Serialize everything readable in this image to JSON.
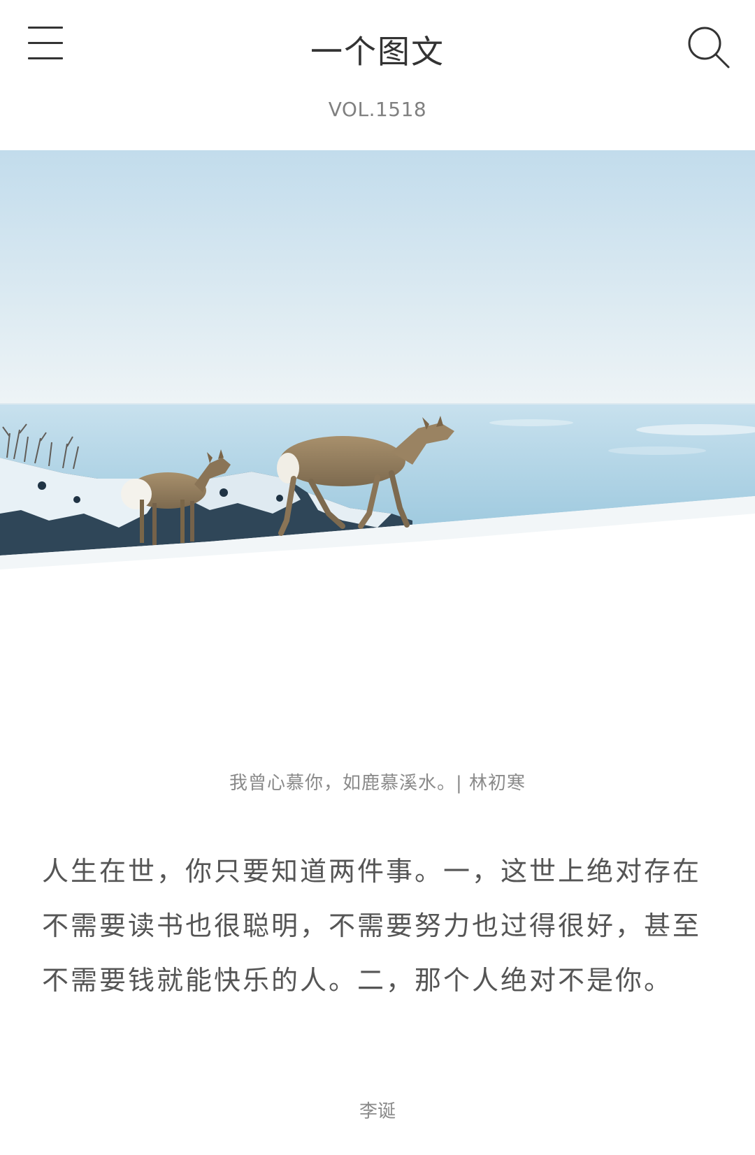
{
  "header": {
    "menu_icon": "menu-icon",
    "title": "一个图文",
    "search_icon": "search-icon",
    "volume": "VOL.1518"
  },
  "photo": {
    "subject": "two deer on snowy cliff above sea"
  },
  "caption": "我曾心慕你，如鹿慕溪水。| 林初寒",
  "article": {
    "text": "人生在世，你只要知道两件事。一，这世上绝对存在不需要读书也很聪明，不需要努力也过得很好，甚至不需要钱就能快乐的人。二，那个人绝对不是你。"
  },
  "author": "李诞",
  "colors": {
    "sky_top": "#c2dcec",
    "sea": "#a9cfe2",
    "snow": "#ffffff",
    "text_primary": "#333333",
    "text_secondary": "#8a8a8a"
  }
}
